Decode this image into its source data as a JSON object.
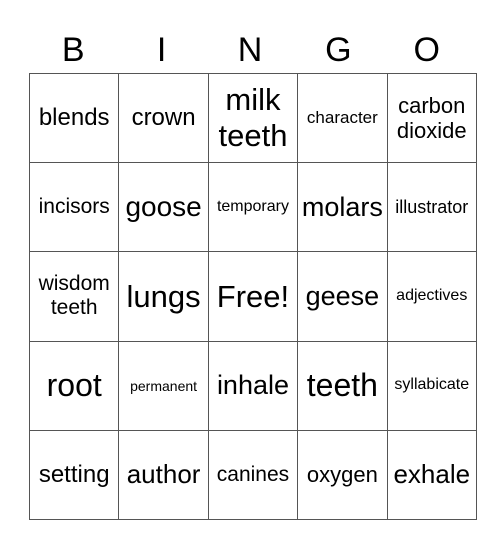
{
  "header": [
    "B",
    "I",
    "N",
    "G",
    "O"
  ],
  "rows": [
    [
      {
        "text": "blends",
        "size": 24
      },
      {
        "text": "crown",
        "size": 24
      },
      {
        "text": "milk teeth",
        "size": 31
      },
      {
        "text": "character",
        "size": 17
      },
      {
        "text": "carbon dioxide",
        "size": 22
      }
    ],
    [
      {
        "text": "incisors",
        "size": 21
      },
      {
        "text": "goose",
        "size": 28
      },
      {
        "text": "temporary",
        "size": 16
      },
      {
        "text": "molars",
        "size": 27
      },
      {
        "text": "illustrator",
        "size": 18
      }
    ],
    [
      {
        "text": "wisdom teeth",
        "size": 21
      },
      {
        "text": "lungs",
        "size": 31
      },
      {
        "text": "Free!",
        "size": 31
      },
      {
        "text": "geese",
        "size": 27
      },
      {
        "text": "adjectives",
        "size": 16
      }
    ],
    [
      {
        "text": "root",
        "size": 32
      },
      {
        "text": "permanent",
        "size": 14
      },
      {
        "text": "inhale",
        "size": 27
      },
      {
        "text": "teeth",
        "size": 32
      },
      {
        "text": "syllabicate",
        "size": 16
      }
    ],
    [
      {
        "text": "setting",
        "size": 24
      },
      {
        "text": "author",
        "size": 26
      },
      {
        "text": "canines",
        "size": 21
      },
      {
        "text": "oxygen",
        "size": 22
      },
      {
        "text": "exhale",
        "size": 26
      }
    ]
  ]
}
